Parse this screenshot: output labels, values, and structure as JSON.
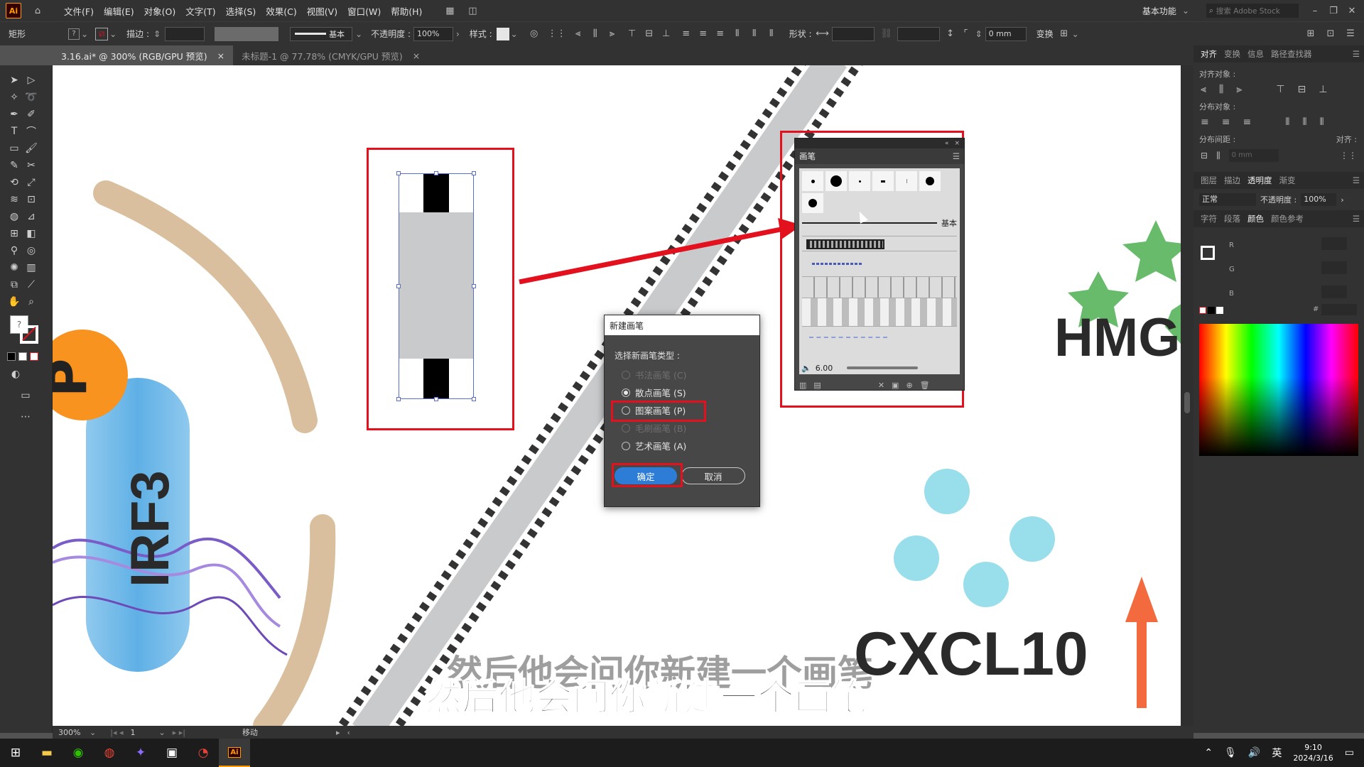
{
  "menubar": {
    "logo": "Ai",
    "items": [
      "文件(F)",
      "编辑(E)",
      "对象(O)",
      "文字(T)",
      "选择(S)",
      "效果(C)",
      "视图(V)",
      "窗口(W)",
      "帮助(H)"
    ],
    "workspace": "基本功能",
    "search_placeholder": "搜索 Adobe Stock"
  },
  "controlbar": {
    "shape_label": "矩形",
    "stroke_label": "描边 :",
    "stroke_style": "基本",
    "opacity_label": "不透明度 :",
    "opacity_value": "100%",
    "style_label": "样式 :",
    "shape_prop_label": "形状 :",
    "corner_value": "0 mm",
    "transform_label": "变换"
  },
  "tabs": [
    {
      "label": "3.16.ai* @ 300% (RGB/GPU 预览)",
      "active": true
    },
    {
      "label": "未标题-1 @ 77.78% (CMYK/GPU 预览)",
      "active": false
    }
  ],
  "right_panel": {
    "tabs1": [
      "对齐",
      "变换",
      "信息",
      "路径查找器"
    ],
    "align_objects": "对齐对象 :",
    "distribute_objects": "分布对象 :",
    "distribute_spacing": "分布间距 :",
    "align_to": "对齐 :",
    "spacing_value": "0 mm",
    "tabs2": [
      "图层",
      "描边",
      "透明度",
      "渐变"
    ],
    "blend_mode": "正常",
    "opacity_label": "不透明度 :",
    "opacity_value": "100%",
    "tabs3": [
      "字符",
      "段落",
      "颜色",
      "颜色参考"
    ],
    "channels": [
      "R",
      "G",
      "B"
    ],
    "hash": "#"
  },
  "dialog": {
    "title": "新建画笔",
    "prompt": "选择新画笔类型 :",
    "options": [
      {
        "label": "书法画笔 (C)",
        "enabled": false,
        "selected": false
      },
      {
        "label": "散点画笔 (S)",
        "enabled": true,
        "selected": true
      },
      {
        "label": "图案画笔 (P)",
        "enabled": true,
        "selected": false
      },
      {
        "label": "毛刷画笔 (B)",
        "enabled": false,
        "selected": false
      },
      {
        "label": "艺术画笔 (A)",
        "enabled": true,
        "selected": false
      }
    ],
    "ok": "确定",
    "cancel": "取消"
  },
  "brush_panel": {
    "title": "画笔",
    "basic_label": "基本",
    "size_value": "6.00"
  },
  "canvas_text": {
    "letter_p": "P",
    "irf3": "IRF3",
    "hmg": "HMG",
    "cxcl10": "CXCL10",
    "subtitle": "然后他会问你新建一个画笔"
  },
  "statusbar": {
    "zoom": "300%",
    "page": "1",
    "mode": "移动"
  },
  "taskbar": {
    "ime": "英",
    "time": "9:10",
    "date": "2024/3/16"
  },
  "colors": {
    "annotation_red": "#e3101d",
    "accent_blue": "#2d7dd6",
    "orange": "#f7931e",
    "cyan": "#7fd6e6",
    "tan": "#d2b48c",
    "green": "#4caf50"
  }
}
